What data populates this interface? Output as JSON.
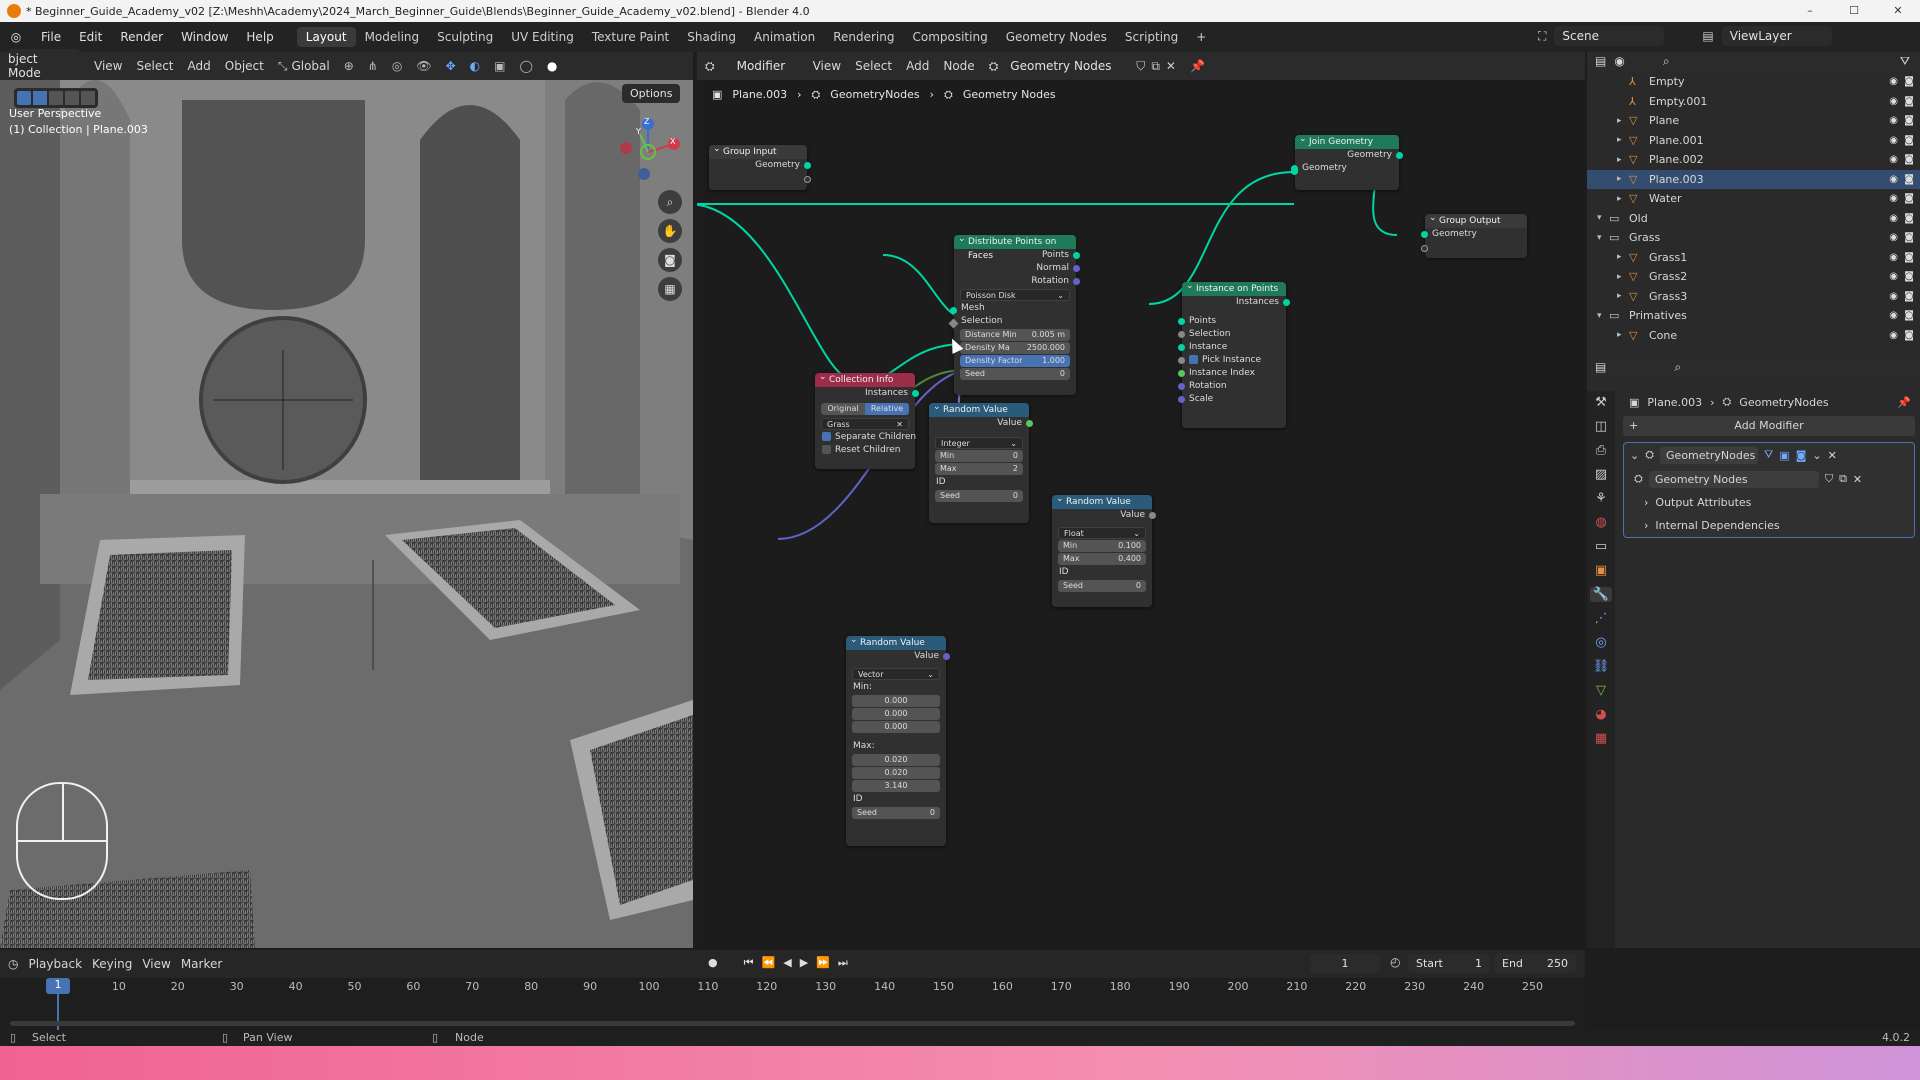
{
  "window": {
    "title": "* Beginner_Guide_Academy_v02 [Z:\\Meshh\\Academy\\2024_March_Beginner_Guide\\Blends\\Beginner_Guide_Academy_v02.blend] - Blender 4.0"
  },
  "menu": {
    "items": [
      "File",
      "Edit",
      "Render",
      "Window",
      "Help"
    ]
  },
  "workspaces": [
    "Layout",
    "Modeling",
    "Sculpting",
    "UV Editing",
    "Texture Paint",
    "Shading",
    "Animation",
    "Rendering",
    "Compositing",
    "Geometry Nodes",
    "Scripting"
  ],
  "scene": {
    "scene_label": "Scene",
    "viewlayer_label": "ViewLayer"
  },
  "viewport": {
    "mode": "bject Mode",
    "menus": [
      "View",
      "Select",
      "Add",
      "Object"
    ],
    "orientation": "Global",
    "options": "Options",
    "perspective": "User Perspective",
    "collection_info": "(1) Collection | Plane.003",
    "axes": {
      "z": "Z",
      "y": "Y",
      "x": "X"
    }
  },
  "node_editor": {
    "editor_type": "Modifier",
    "menus": [
      "View",
      "Select",
      "Add",
      "Node"
    ],
    "tree_name": "Geometry Nodes",
    "breadcrumb": [
      "Plane.003",
      "GeometryNodes",
      "Geometry Nodes"
    ]
  },
  "nodes": {
    "group_input": {
      "title": "Group Input",
      "out": "Geometry"
    },
    "join_geometry": {
      "title": "Join Geometry",
      "out": "Geometry",
      "in": "Geometry"
    },
    "group_output": {
      "title": "Group Output",
      "in": "Geometry"
    },
    "distribute": {
      "title": "Distribute Points on Faces",
      "outs": [
        "Points",
        "Normal",
        "Rotation"
      ],
      "mode": "Poisson Disk",
      "ins": [
        "Mesh",
        "Selection"
      ],
      "dist_label": "Distance Min",
      "dist_val": "0.005 m",
      "dens_label": "Density Ma",
      "dens_val": "2500.000",
      "fac_label": "Density Factor",
      "fac_val": "1.000",
      "seed_label": "Seed",
      "seed_val": "0"
    },
    "instance_on_points": {
      "title": "Instance on Points",
      "out": "Instances",
      "ins": [
        "Points",
        "Selection",
        "Instance",
        "Pick Instance",
        "Instance Index",
        "Rotation",
        "Scale"
      ]
    },
    "collection_info": {
      "title": "Collection Info",
      "out": "Instances",
      "btn_original": "Original",
      "btn_relative": "Relative",
      "collection": "Grass",
      "separate": "Separate Children",
      "reset": "Reset Children"
    },
    "random_int": {
      "title": "Random Value",
      "out": "Value",
      "type": "Integer",
      "min_label": "Min",
      "min": "0",
      "max_label": "Max",
      "max": "2",
      "id": "ID",
      "seed_label": "Seed",
      "seed": "0"
    },
    "random_float": {
      "title": "Random Value",
      "out": "Value",
      "type": "Float",
      "min_label": "Min",
      "min": "0.100",
      "max_label": "Max",
      "max": "0.400",
      "id": "ID",
      "seed_label": "Seed",
      "seed": "0"
    },
    "random_vec": {
      "title": "Random Value",
      "out": "Value",
      "type": "Vector",
      "min_label": "Min:",
      "min": [
        "0.000",
        "0.000",
        "0.000"
      ],
      "max_label": "Max:",
      "max": [
        "0.020",
        "0.020",
        "3.140"
      ],
      "id": "ID",
      "seed_label": "Seed",
      "seed": "0"
    }
  },
  "outliner": {
    "rows": [
      {
        "name": "Empty",
        "indent": 2,
        "type": "empty"
      },
      {
        "name": "Empty.001",
        "indent": 2,
        "type": "empty"
      },
      {
        "name": "Plane",
        "indent": 2,
        "type": "mesh"
      },
      {
        "name": "Plane.001",
        "indent": 2,
        "type": "mesh"
      },
      {
        "name": "Plane.002",
        "indent": 2,
        "type": "mesh"
      },
      {
        "name": "Plane.003",
        "indent": 2,
        "type": "mesh"
      },
      {
        "name": "Water",
        "indent": 2,
        "type": "mesh"
      },
      {
        "name": "Old",
        "indent": 1,
        "type": "coll"
      },
      {
        "name": "Grass",
        "indent": 1,
        "type": "coll"
      },
      {
        "name": "Grass1",
        "indent": 2,
        "type": "mesh"
      },
      {
        "name": "Grass2",
        "indent": 2,
        "type": "mesh"
      },
      {
        "name": "Grass3",
        "indent": 2,
        "type": "mesh"
      },
      {
        "name": "Primatives",
        "indent": 1,
        "type": "coll"
      },
      {
        "name": "Cone",
        "indent": 2,
        "type": "mesh"
      }
    ]
  },
  "properties": {
    "breadcrumb": [
      "Plane.003",
      "GeometryNodes"
    ],
    "add_modifier": "Add Modifier",
    "modifier_name": "GeometryNodes",
    "tree": "Geometry Nodes",
    "panels": [
      "Output Attributes",
      "Internal Dependencies"
    ]
  },
  "timeline": {
    "menus": [
      "Playback",
      "Keying",
      "View",
      "Marker"
    ],
    "current": "1",
    "start_label": "Start",
    "start": "1",
    "end_label": "End",
    "end": "250",
    "ticks": [
      "10",
      "20",
      "30",
      "40",
      "50",
      "60",
      "70",
      "80",
      "90",
      "100",
      "110",
      "120",
      "130",
      "140",
      "150",
      "160",
      "170",
      "180",
      "190",
      "200",
      "210",
      "220",
      "230",
      "240",
      "250"
    ],
    "frame_marker": "1"
  },
  "status": {
    "select": "Select",
    "pan": "Pan View",
    "node": "Node",
    "version": "4.0.2"
  }
}
